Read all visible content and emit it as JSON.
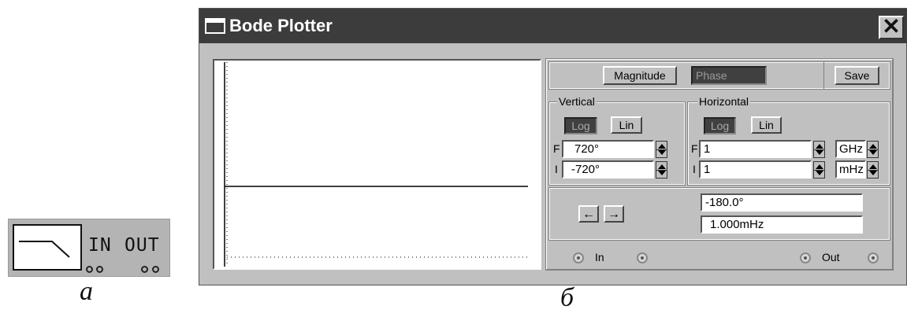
{
  "icon": {
    "in_label": "IN",
    "out_label": "OUT"
  },
  "captions": {
    "a": "a",
    "b": "б"
  },
  "window": {
    "title": "Bode Plotter",
    "close_label": "✕"
  },
  "mode": {
    "magnitude_label": "Magnitude",
    "phase_label": "Phase",
    "save_label": "Save"
  },
  "vertical": {
    "legend": "Vertical",
    "log_label": "Log",
    "lin_label": "Lin",
    "f_label": "F",
    "i_label": "I",
    "f_value": "720°",
    "i_value": "-720°"
  },
  "horizontal": {
    "legend": "Horizontal",
    "log_label": "Log",
    "lin_label": "Lin",
    "f_label": "F",
    "i_label": "I",
    "f_value": "1",
    "i_value": "1",
    "f_unit": "GHz",
    "i_unit": "mHz"
  },
  "readout": {
    "left_arrow": "←",
    "right_arrow": "→",
    "phase_value": "-180.0°",
    "freq_value": "1.000mHz"
  },
  "terminals": {
    "in_label": "In",
    "out_label": "Out"
  },
  "colors": {
    "titlebar": "#3c3c3c",
    "panel": "#c0c0c0",
    "active_button": "#404040"
  }
}
